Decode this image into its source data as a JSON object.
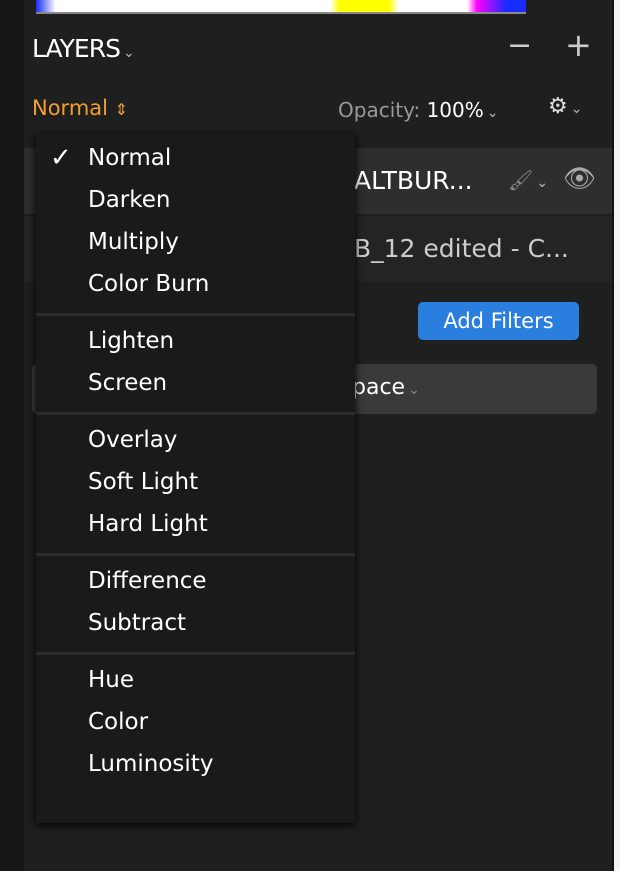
{
  "panel": {
    "title": "LAYERS",
    "minus": "−",
    "plus": "+"
  },
  "toolbar": {
    "blend_mode": "Normal",
    "opacity_label": "Opacity:",
    "opacity_value": "100%"
  },
  "layers": [
    {
      "name": "ALTBUR...",
      "selected": true
    },
    {
      "name": "B_12 edited - C..."
    }
  ],
  "add_filters": "Add Filters",
  "workspace": {
    "value": "pace"
  },
  "blend_menu": {
    "selected": "Normal",
    "groups": [
      [
        "Normal",
        "Darken",
        "Multiply",
        "Color Burn"
      ],
      [
        "Lighten",
        "Screen"
      ],
      [
        "Overlay",
        "Soft Light",
        "Hard Light"
      ],
      [
        "Difference",
        "Subtract"
      ],
      [
        "Hue",
        "Color",
        "Luminosity"
      ]
    ]
  },
  "colors": {
    "accent": "#f0a030",
    "button": "#2a7fde",
    "background": "#1f1f1f"
  }
}
